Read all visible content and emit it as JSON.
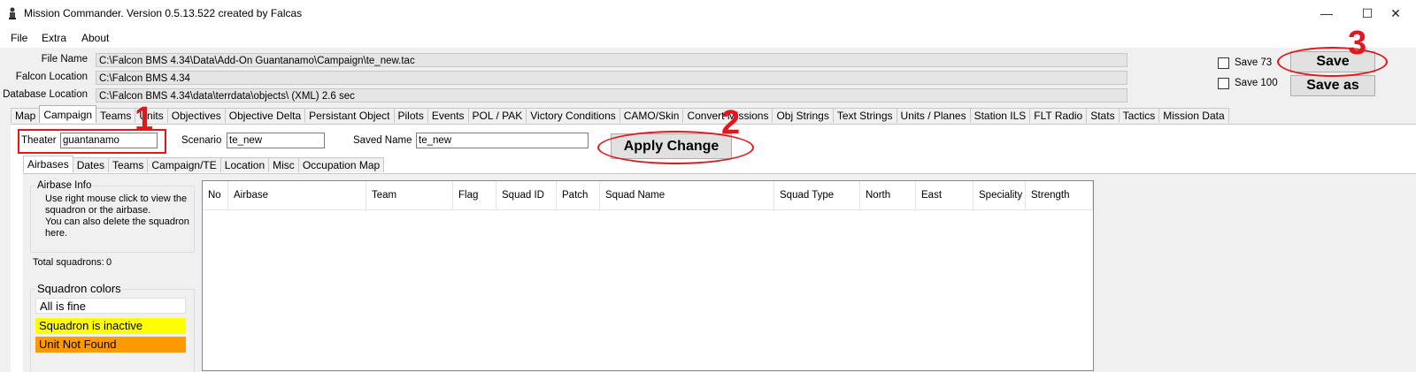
{
  "window": {
    "title": "Mission Commander. Version 0.5.13.522 created by Falcas",
    "minimize_glyph": "—",
    "maximize_glyph": "☐",
    "close_glyph": "✕"
  },
  "menu": [
    "File",
    "Extra",
    "About"
  ],
  "paths": {
    "file_name_label": "File Name",
    "file_name_value": "C:\\Falcon BMS 4.34\\Data\\Add-On Guantanamo\\Campaign\\te_new.tac",
    "falcon_location_label": "Falcon Location",
    "falcon_location_value": "C:\\Falcon BMS 4.34",
    "database_location_label": "Database Location",
    "database_location_value": "C:\\Falcon BMS 4.34\\data\\terrdata\\objects\\ (XML) 2.6 sec"
  },
  "save_options": {
    "save73_label": "Save 73",
    "save73_checked": false,
    "save100_label": "Save 100",
    "save100_checked": false,
    "save_label": "Save",
    "save_as_label": "Save as"
  },
  "main_tabs": [
    "Map",
    "Campaign",
    "Teams",
    "Units",
    "Objectives",
    "Objective Delta",
    "Persistant Object",
    "Pilots",
    "Events",
    "POL / PAK",
    "Victory Conditions",
    "CAMO/Skin",
    "Convert Missions",
    "Obj Strings",
    "Text Strings",
    "Units / Planes",
    "Station ILS",
    "FLT Radio",
    "Stats",
    "Tactics",
    "Mission Data"
  ],
  "selected_main_tab": "Campaign",
  "campaign": {
    "theater_label": "Theater",
    "theater_value": "guantanamo",
    "scenario_label": "Scenario",
    "scenario_value": "te_new",
    "saved_name_label": "Saved Name",
    "saved_name_value": "te_new",
    "apply_label": "Apply Change"
  },
  "sub_tabs": [
    "Airbases",
    "Dates",
    "Teams",
    "Campaign/TE",
    "Location",
    "Misc",
    "Occupation Map"
  ],
  "selected_sub_tab": "Airbases",
  "airbase_info": {
    "title": "Airbase Info",
    "text_line1": "Use right mouse click to view the",
    "text_line2": "squadron or the airbase.",
    "text_line3": "You can also delete the squadron",
    "text_line4": "here.",
    "total_label": "Total squadrons:",
    "total_value": "0"
  },
  "squadron_colors": {
    "title": "Squadron colors",
    "items": [
      {
        "label": "All is fine",
        "color": "#ffffff"
      },
      {
        "label": "Squadron is inactive",
        "color": "#ffff00"
      },
      {
        "label": "Unit Not Found",
        "color": "#ff9900"
      }
    ]
  },
  "grid_columns": [
    "No",
    "Airbase",
    "Team",
    "Flag",
    "Squad ID",
    "Patch",
    "Squad Name",
    "Squad Type",
    "North",
    "East",
    "Speciality",
    "Strength"
  ],
  "annotations": {
    "one": "1",
    "two": "2",
    "three": "3",
    "color": "#e4161b"
  }
}
